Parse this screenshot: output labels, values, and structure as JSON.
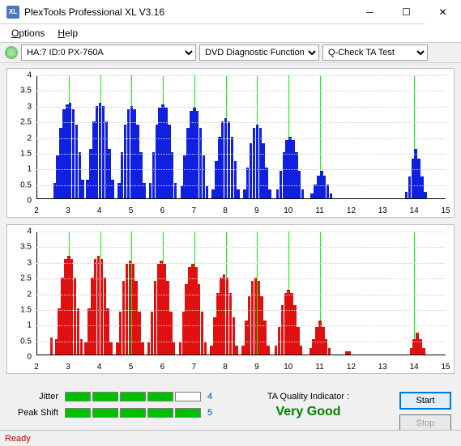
{
  "window": {
    "title": "PlexTools Professional XL V3.16"
  },
  "menu": {
    "options": "Options",
    "help": "Help"
  },
  "toolbar": {
    "drive": "HA:7 ID:0   PX-760A",
    "function": "DVD Diagnostic Functions",
    "test": "Q-Check TA Test"
  },
  "chart_data": [
    {
      "type": "bar",
      "color": "#1020e0",
      "xlim": [
        2,
        15
      ],
      "ylim": [
        0,
        4
      ],
      "xticks": [
        2,
        3,
        4,
        5,
        6,
        7,
        8,
        9,
        10,
        11,
        12,
        13,
        14,
        15
      ],
      "yticks": [
        0,
        0.5,
        1,
        1.5,
        2,
        2.5,
        3,
        3.5,
        4
      ],
      "markers": [
        3,
        4,
        5,
        6,
        7,
        8,
        9,
        10,
        11,
        14
      ],
      "bars": [
        {
          "x": 2.55,
          "h": 0.5
        },
        {
          "x": 2.65,
          "h": 1.4
        },
        {
          "x": 2.75,
          "h": 2.3
        },
        {
          "x": 2.85,
          "h": 2.9
        },
        {
          "x": 2.95,
          "h": 3.05
        },
        {
          "x": 3.05,
          "h": 3.1
        },
        {
          "x": 3.15,
          "h": 2.9
        },
        {
          "x": 3.25,
          "h": 2.4
        },
        {
          "x": 3.35,
          "h": 1.5
        },
        {
          "x": 3.45,
          "h": 0.6
        },
        {
          "x": 3.6,
          "h": 0.6
        },
        {
          "x": 3.7,
          "h": 1.6
        },
        {
          "x": 3.8,
          "h": 2.5
        },
        {
          "x": 3.9,
          "h": 3.0
        },
        {
          "x": 4.0,
          "h": 3.1
        },
        {
          "x": 4.1,
          "h": 3.0
        },
        {
          "x": 4.2,
          "h": 2.5
        },
        {
          "x": 4.3,
          "h": 1.6
        },
        {
          "x": 4.4,
          "h": 0.6
        },
        {
          "x": 4.6,
          "h": 0.5
        },
        {
          "x": 4.7,
          "h": 1.5
        },
        {
          "x": 4.8,
          "h": 2.4
        },
        {
          "x": 4.9,
          "h": 2.9
        },
        {
          "x": 5.0,
          "h": 3.0
        },
        {
          "x": 5.1,
          "h": 2.9
        },
        {
          "x": 5.2,
          "h": 2.4
        },
        {
          "x": 5.3,
          "h": 1.5
        },
        {
          "x": 5.4,
          "h": 0.5
        },
        {
          "x": 5.6,
          "h": 0.5
        },
        {
          "x": 5.7,
          "h": 1.5
        },
        {
          "x": 5.8,
          "h": 2.4
        },
        {
          "x": 5.9,
          "h": 2.95
        },
        {
          "x": 6.0,
          "h": 3.05
        },
        {
          "x": 6.1,
          "h": 2.95
        },
        {
          "x": 6.2,
          "h": 2.4
        },
        {
          "x": 6.3,
          "h": 1.5
        },
        {
          "x": 6.4,
          "h": 0.5
        },
        {
          "x": 6.6,
          "h": 0.4
        },
        {
          "x": 6.7,
          "h": 1.4
        },
        {
          "x": 6.8,
          "h": 2.3
        },
        {
          "x": 6.9,
          "h": 2.85
        },
        {
          "x": 7.0,
          "h": 2.95
        },
        {
          "x": 7.1,
          "h": 2.85
        },
        {
          "x": 7.2,
          "h": 2.3
        },
        {
          "x": 7.3,
          "h": 1.4
        },
        {
          "x": 7.4,
          "h": 0.4
        },
        {
          "x": 7.6,
          "h": 0.3
        },
        {
          "x": 7.7,
          "h": 1.2
        },
        {
          "x": 7.8,
          "h": 2.0
        },
        {
          "x": 7.9,
          "h": 2.5
        },
        {
          "x": 8.0,
          "h": 2.6
        },
        {
          "x": 8.1,
          "h": 2.5
        },
        {
          "x": 8.2,
          "h": 2.0
        },
        {
          "x": 8.3,
          "h": 1.2
        },
        {
          "x": 8.4,
          "h": 0.3
        },
        {
          "x": 8.6,
          "h": 0.3
        },
        {
          "x": 8.7,
          "h": 1.0
        },
        {
          "x": 8.8,
          "h": 1.8
        },
        {
          "x": 8.9,
          "h": 2.3
        },
        {
          "x": 9.0,
          "h": 2.4
        },
        {
          "x": 9.1,
          "h": 2.3
        },
        {
          "x": 9.2,
          "h": 1.8
        },
        {
          "x": 9.3,
          "h": 1.0
        },
        {
          "x": 9.4,
          "h": 0.3
        },
        {
          "x": 9.65,
          "h": 0.3
        },
        {
          "x": 9.75,
          "h": 0.9
        },
        {
          "x": 9.85,
          "h": 1.5
        },
        {
          "x": 9.95,
          "h": 1.9
        },
        {
          "x": 10.05,
          "h": 2.0
        },
        {
          "x": 10.15,
          "h": 1.9
        },
        {
          "x": 10.25,
          "h": 1.5
        },
        {
          "x": 10.35,
          "h": 0.9
        },
        {
          "x": 10.45,
          "h": 0.3
        },
        {
          "x": 10.75,
          "h": 0.15
        },
        {
          "x": 10.85,
          "h": 0.45
        },
        {
          "x": 10.95,
          "h": 0.75
        },
        {
          "x": 11.05,
          "h": 0.9
        },
        {
          "x": 11.15,
          "h": 0.75
        },
        {
          "x": 11.25,
          "h": 0.45
        },
        {
          "x": 11.35,
          "h": 0.15
        },
        {
          "x": 13.75,
          "h": 0.2
        },
        {
          "x": 13.85,
          "h": 0.7
        },
        {
          "x": 13.95,
          "h": 1.3
        },
        {
          "x": 14.05,
          "h": 1.6
        },
        {
          "x": 14.15,
          "h": 1.3
        },
        {
          "x": 14.25,
          "h": 0.7
        },
        {
          "x": 14.35,
          "h": 0.2
        }
      ]
    },
    {
      "type": "bar",
      "color": "#e01010",
      "xlim": [
        2,
        15
      ],
      "ylim": [
        0,
        4
      ],
      "xticks": [
        2,
        3,
        4,
        5,
        6,
        7,
        8,
        9,
        10,
        11,
        12,
        13,
        14,
        15
      ],
      "yticks": [
        0,
        0.5,
        1,
        1.5,
        2,
        2.5,
        3,
        3.5,
        4
      ],
      "markers": [
        3,
        4,
        5,
        6,
        7,
        8,
        9,
        10,
        11,
        14
      ],
      "bars": [
        {
          "x": 2.45,
          "h": 0.55
        },
        {
          "x": 2.6,
          "h": 0.5
        },
        {
          "x": 2.7,
          "h": 1.5
        },
        {
          "x": 2.8,
          "h": 2.5
        },
        {
          "x": 2.9,
          "h": 3.1
        },
        {
          "x": 3.0,
          "h": 3.2
        },
        {
          "x": 3.1,
          "h": 3.1
        },
        {
          "x": 3.2,
          "h": 2.5
        },
        {
          "x": 3.3,
          "h": 1.5
        },
        {
          "x": 3.4,
          "h": 0.5
        },
        {
          "x": 3.55,
          "h": 0.4
        },
        {
          "x": 3.65,
          "h": 1.5
        },
        {
          "x": 3.75,
          "h": 2.5
        },
        {
          "x": 3.85,
          "h": 3.1
        },
        {
          "x": 3.95,
          "h": 3.2
        },
        {
          "x": 4.05,
          "h": 3.1
        },
        {
          "x": 4.15,
          "h": 2.5
        },
        {
          "x": 4.25,
          "h": 1.5
        },
        {
          "x": 4.35,
          "h": 0.4
        },
        {
          "x": 4.55,
          "h": 0.4
        },
        {
          "x": 4.65,
          "h": 1.4
        },
        {
          "x": 4.75,
          "h": 2.4
        },
        {
          "x": 4.85,
          "h": 2.95
        },
        {
          "x": 4.95,
          "h": 3.05
        },
        {
          "x": 5.05,
          "h": 2.95
        },
        {
          "x": 5.15,
          "h": 2.4
        },
        {
          "x": 5.25,
          "h": 1.4
        },
        {
          "x": 5.35,
          "h": 0.4
        },
        {
          "x": 5.55,
          "h": 0.4
        },
        {
          "x": 5.65,
          "h": 1.4
        },
        {
          "x": 5.75,
          "h": 2.4
        },
        {
          "x": 5.85,
          "h": 2.95
        },
        {
          "x": 5.95,
          "h": 3.05
        },
        {
          "x": 6.05,
          "h": 2.95
        },
        {
          "x": 6.15,
          "h": 2.4
        },
        {
          "x": 6.25,
          "h": 1.4
        },
        {
          "x": 6.35,
          "h": 0.4
        },
        {
          "x": 6.55,
          "h": 0.4
        },
        {
          "x": 6.65,
          "h": 1.4
        },
        {
          "x": 6.75,
          "h": 2.3
        },
        {
          "x": 6.85,
          "h": 2.85
        },
        {
          "x": 6.95,
          "h": 2.95
        },
        {
          "x": 7.05,
          "h": 2.85
        },
        {
          "x": 7.15,
          "h": 2.3
        },
        {
          "x": 7.25,
          "h": 1.4
        },
        {
          "x": 7.35,
          "h": 0.4
        },
        {
          "x": 7.55,
          "h": 0.3
        },
        {
          "x": 7.65,
          "h": 1.2
        },
        {
          "x": 7.75,
          "h": 2.0
        },
        {
          "x": 7.85,
          "h": 2.5
        },
        {
          "x": 7.95,
          "h": 2.6
        },
        {
          "x": 8.05,
          "h": 2.5
        },
        {
          "x": 8.15,
          "h": 2.0
        },
        {
          "x": 8.25,
          "h": 1.2
        },
        {
          "x": 8.35,
          "h": 0.3
        },
        {
          "x": 8.55,
          "h": 0.3
        },
        {
          "x": 8.65,
          "h": 1.1
        },
        {
          "x": 8.75,
          "h": 1.9
        },
        {
          "x": 8.85,
          "h": 2.4
        },
        {
          "x": 8.95,
          "h": 2.5
        },
        {
          "x": 9.05,
          "h": 2.4
        },
        {
          "x": 9.15,
          "h": 1.9
        },
        {
          "x": 9.25,
          "h": 1.1
        },
        {
          "x": 9.35,
          "h": 0.3
        },
        {
          "x": 9.6,
          "h": 0.3
        },
        {
          "x": 9.7,
          "h": 0.9
        },
        {
          "x": 9.8,
          "h": 1.6
        },
        {
          "x": 9.9,
          "h": 2.0
        },
        {
          "x": 10.0,
          "h": 2.1
        },
        {
          "x": 10.1,
          "h": 2.0
        },
        {
          "x": 10.2,
          "h": 1.6
        },
        {
          "x": 10.3,
          "h": 0.9
        },
        {
          "x": 10.4,
          "h": 0.3
        },
        {
          "x": 10.7,
          "h": 0.2
        },
        {
          "x": 10.8,
          "h": 0.5
        },
        {
          "x": 10.9,
          "h": 0.9
        },
        {
          "x": 11.0,
          "h": 1.1
        },
        {
          "x": 11.1,
          "h": 0.9
        },
        {
          "x": 11.2,
          "h": 0.5
        },
        {
          "x": 11.3,
          "h": 0.2
        },
        {
          "x": 11.85,
          "h": 0.1
        },
        {
          "x": 11.95,
          "h": 0.1
        },
        {
          "x": 13.9,
          "h": 0.2
        },
        {
          "x": 14.0,
          "h": 0.5
        },
        {
          "x": 14.1,
          "h": 0.7
        },
        {
          "x": 14.2,
          "h": 0.5
        },
        {
          "x": 14.3,
          "h": 0.2
        }
      ]
    }
  ],
  "meters": {
    "jitter": {
      "label": "Jitter",
      "filled": 4,
      "total": 5,
      "value": "4"
    },
    "peakshift": {
      "label": "Peak Shift",
      "filled": 5,
      "total": 5,
      "value": "5"
    }
  },
  "tq": {
    "label": "TA Quality Indicator :",
    "value": "Very Good"
  },
  "buttons": {
    "start": "Start",
    "stop": "Stop"
  },
  "status": "Ready"
}
